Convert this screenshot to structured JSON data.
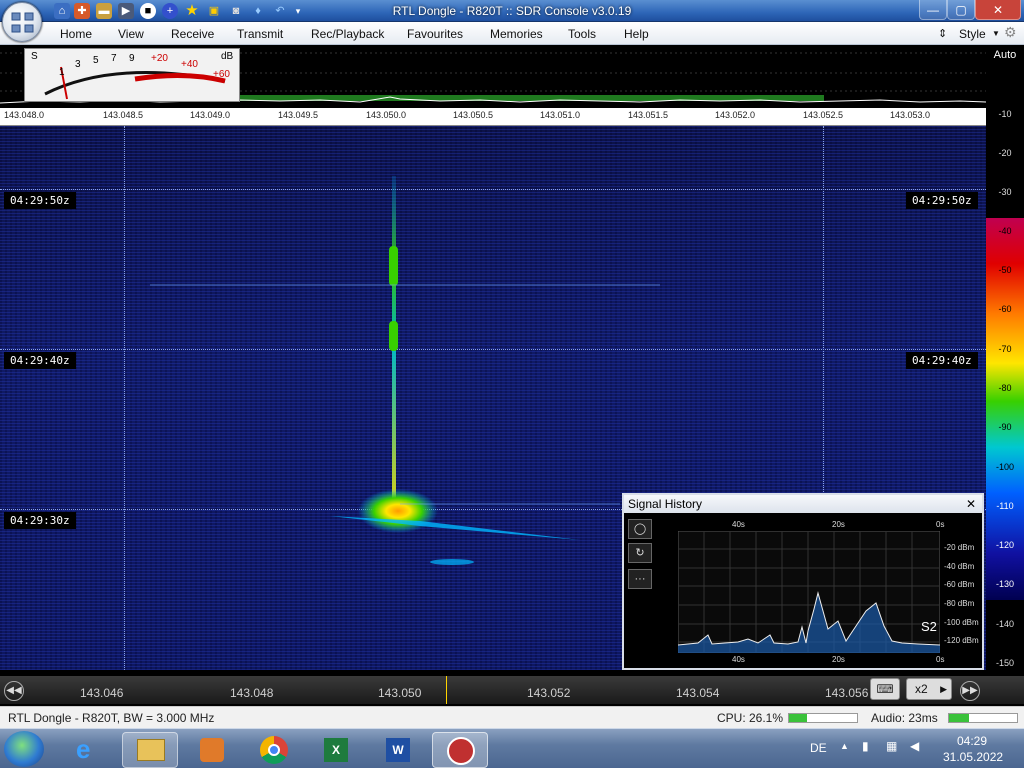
{
  "window": {
    "title": "RTL Dongle - R820T :: SDR Console v3.0.19",
    "controls": {
      "minimize": "—",
      "maximize": "▢",
      "close": "✕"
    }
  },
  "quick_access": [
    "home-icon",
    "lifebuoy-icon",
    "folder-icon",
    "play-icon",
    "stop-icon",
    "plus-icon",
    "star-icon",
    "lock-icon",
    "camera-icon",
    "drop-icon",
    "undo-icon",
    "dropdown-icon"
  ],
  "menu": {
    "items": [
      "Home",
      "View",
      "Receive",
      "Transmit",
      "Rec/Playback",
      "Favourites",
      "Memories",
      "Tools",
      "Help"
    ],
    "style_label": "Style"
  },
  "smeter": {
    "s_label": "S",
    "db_label": "dB",
    "scale_s": [
      "1",
      "3",
      "5",
      "7",
      "9"
    ],
    "scale_db": [
      "+20",
      "+40",
      "+60"
    ]
  },
  "freq_scale": [
    "143.048.0",
    "143.048.5",
    "143.049.0",
    "143.049.5",
    "143.050.0",
    "143.050.5",
    "143.051.0",
    "143.051.5",
    "143.052.0",
    "143.052.5",
    "143.053.0"
  ],
  "db_scale": {
    "auto": "Auto",
    "ticks": [
      "-10",
      "-20",
      "-30",
      "-40",
      "-50",
      "-60",
      "-70",
      "-80",
      "-90",
      "-100",
      "-110",
      "-120",
      "-130",
      "-140",
      "-150"
    ]
  },
  "waterfall": {
    "time_labels": [
      "04:29:50z",
      "04:29:40z",
      "04:29:30z"
    ]
  },
  "signal_history": {
    "title": "Signal History",
    "close": "✕",
    "time_top": [
      "40s",
      "20s",
      "0s"
    ],
    "time_bottom": [
      "40s",
      "20s",
      "0s"
    ],
    "dbm_labels": [
      "-20 dBm",
      "-40 dBm",
      "-60 dBm",
      "-80 dBm",
      "-100 dBm",
      "-120 dBm"
    ],
    "s_reading": "S2",
    "buttons": [
      "◯",
      "↻",
      "···"
    ]
  },
  "bottom_bar": {
    "freqs": [
      "143.046",
      "143.048",
      "143.050",
      "143.052",
      "143.054",
      "143.056"
    ],
    "zoom": "x2",
    "zoom_arrow": "▶"
  },
  "status": {
    "device": "RTL Dongle - R820T, BW = 3.000 MHz",
    "cpu": "CPU: 26.1%",
    "cpu_value": 0.261,
    "audio": "Audio: 23ms",
    "audio_value": 0.3
  },
  "taskbar": {
    "lang": "DE",
    "time": "04:29",
    "date": "31.05.2022"
  },
  "colors": {
    "waterfall_bg": "#101a66",
    "signal_core": "#ffe600",
    "signal_mid": "#38d000",
    "trace": "#00b8ff"
  }
}
